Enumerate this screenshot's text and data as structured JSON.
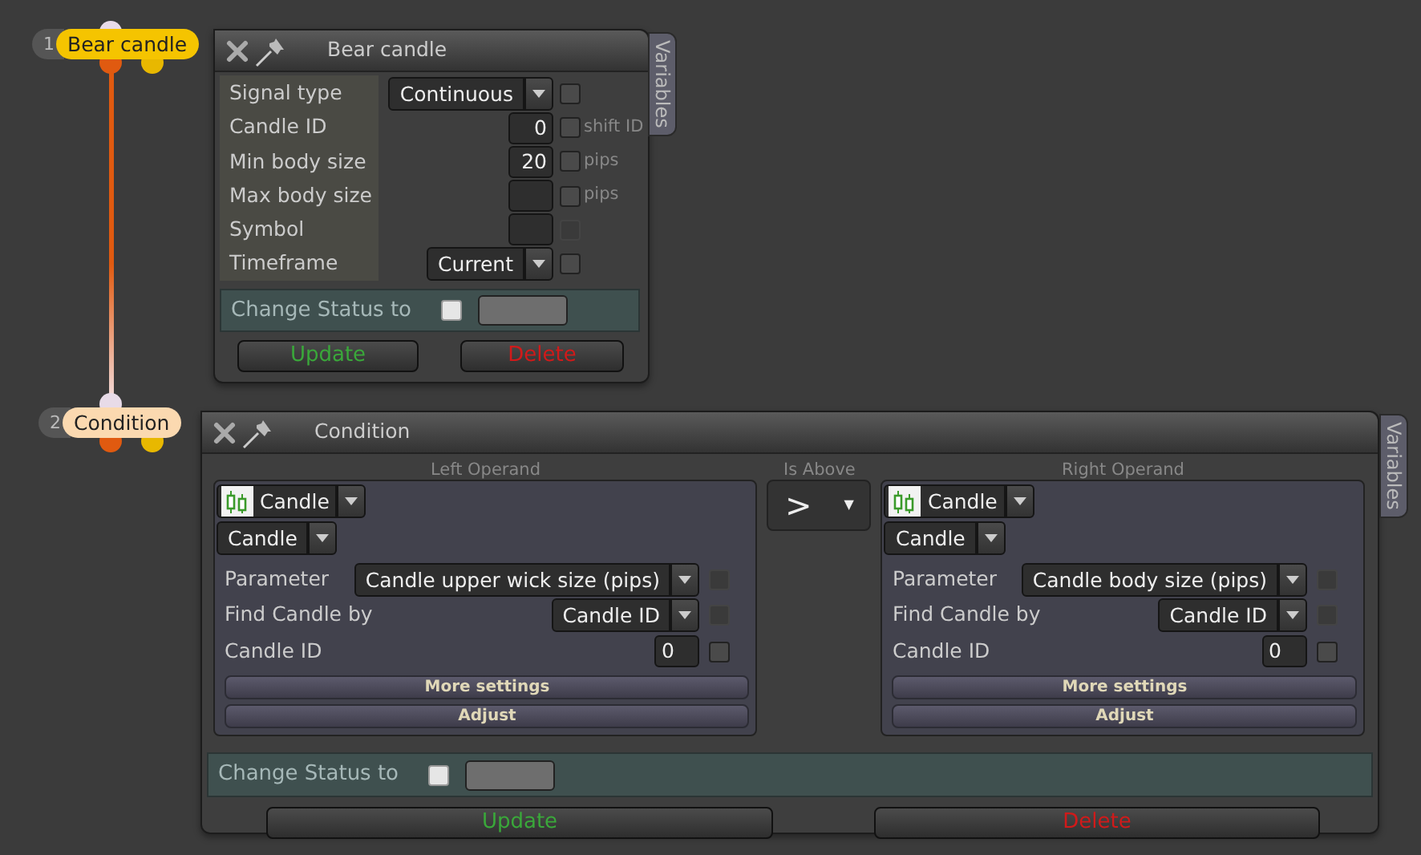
{
  "nodes": [
    {
      "number": "1",
      "label": "Bear candle",
      "color": "#f5c400"
    },
    {
      "number": "2",
      "label": "Condition",
      "color": "#fbd9b0"
    }
  ],
  "signal_panel": {
    "title": "Bear candle",
    "side_tab": "Variables",
    "rows": [
      {
        "label": "Signal type",
        "kind": "select",
        "value": "Continuous",
        "checked": false,
        "disabled": false
      },
      {
        "label": "Candle ID",
        "kind": "input",
        "value": "0",
        "checked": false,
        "disabled": false,
        "suffix": "shift ID"
      },
      {
        "label": "Min body size",
        "kind": "input",
        "value": "20",
        "checked": false,
        "disabled": false,
        "suffix": "pips"
      },
      {
        "label": "Max body size",
        "kind": "input",
        "value": "",
        "checked": false,
        "disabled": false,
        "suffix": "pips"
      },
      {
        "label": "Symbol",
        "kind": "input",
        "value": "",
        "checked": false,
        "disabled": true
      },
      {
        "label": "Timeframe",
        "kind": "select",
        "value": "Current",
        "checked": false,
        "disabled": false
      }
    ],
    "status": {
      "label": "Change Status to",
      "checked": false
    },
    "buttons": [
      {
        "label": "Update",
        "kind": "update"
      },
      {
        "label": "Delete",
        "kind": "delete"
      }
    ]
  },
  "condition_panel": {
    "title": "Condition",
    "side_tab": "Variables",
    "operands": [
      {
        "heading": "Left Operand",
        "source": "Candle",
        "subsource": "Candle",
        "rows": [
          {
            "label": "Parameter",
            "kind": "select",
            "value": "Candle upper wick size (pips)",
            "checked": false,
            "disabled": true
          },
          {
            "label": "Find Candle by",
            "kind": "select",
            "value": "Candle ID",
            "checked": false,
            "disabled": true
          },
          {
            "label": "Candle ID",
            "kind": "input",
            "value": "0",
            "checked": false,
            "disabled": false
          }
        ],
        "buttons": [
          "More settings",
          "Adjust"
        ]
      },
      {
        "heading": "Right Operand",
        "source": "Candle",
        "subsource": "Candle",
        "rows": [
          {
            "label": "Parameter",
            "kind": "select",
            "value": "Candle body size (pips)",
            "checked": false,
            "disabled": true
          },
          {
            "label": "Find Candle by",
            "kind": "select",
            "value": "Candle ID",
            "checked": false,
            "disabled": true
          },
          {
            "label": "Candle ID",
            "kind": "input",
            "value": "0",
            "checked": false,
            "disabled": false
          }
        ],
        "buttons": [
          "More settings",
          "Adjust"
        ]
      }
    ],
    "operator": {
      "heading": "Is Above",
      "symbol": ">",
      "arrow": "▼"
    },
    "status": {
      "label": "Change Status to",
      "checked": false
    },
    "buttons": [
      {
        "label": "Update",
        "kind": "update"
      },
      {
        "label": "Delete",
        "kind": "delete"
      }
    ]
  }
}
